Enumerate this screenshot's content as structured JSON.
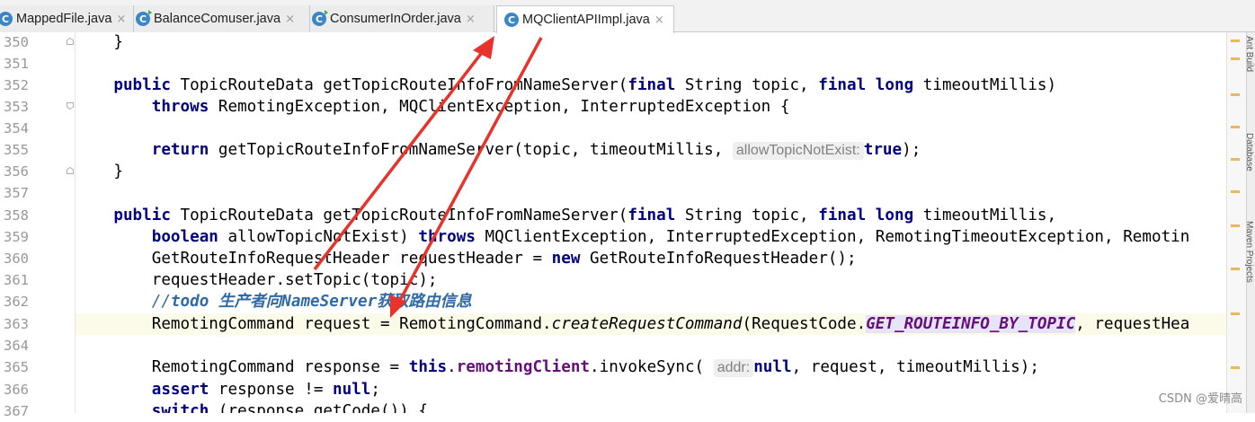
{
  "tabs": [
    {
      "label": "MappedFile.java",
      "icon": "C",
      "run": false
    },
    {
      "label": "BalanceComuser.java",
      "icon": "C",
      "run": true
    },
    {
      "label": "ConsumerInOrder.java",
      "icon": "C",
      "run": true
    },
    {
      "label": "MQClientAPIImpl.java",
      "icon": "C",
      "run": false
    }
  ],
  "close_glyph": "×",
  "line_numbers": [
    "350",
    "351",
    "352",
    "353",
    "354",
    "355",
    "356",
    "357",
    "358",
    "359",
    "360",
    "361",
    "362",
    "363",
    "364",
    "365",
    "366",
    "367"
  ],
  "code": {
    "l350_brace": "}",
    "l352_kw1": "public",
    "l352_a": " TopicRouteData getTopicRouteInfoFromNameServer(",
    "l352_kw2": "final",
    "l352_b": " String topic, ",
    "l352_kw3": "final",
    "l352_c": " ",
    "l352_kw4": "long",
    "l352_d": " timeoutMillis)",
    "l353_kw1": "throws",
    "l353_a": " RemotingException, MQClientException, InterruptedException {",
    "l355_kw1": "return",
    "l355_a": " getTopicRouteInfoFromNameServer(topic, timeoutMillis, ",
    "l355_hint": "allowTopicNotExist:",
    "l355_kw2": "true",
    "l355_b": ");",
    "l356_brace": "}",
    "l358_kw1": "public",
    "l358_a": " TopicRouteData getTopicRouteInfoFromNameServer(",
    "l358_kw2": "final",
    "l358_b": " String topic, ",
    "l358_kw3": "final",
    "l358_c": " ",
    "l358_kw4": "long",
    "l358_d": " timeoutMillis,",
    "l359_kw1": "boolean",
    "l359_a": " allowTopicNotExist) ",
    "l359_kw2": "throws",
    "l359_b": " MQClientException, InterruptedException, RemotingTimeoutException, Remotin",
    "l360_a": "GetRouteInfoRequestHeader requestHeader = ",
    "l360_kw1": "new",
    "l360_b": " GetRouteInfoRequestHeader();",
    "l361_a": "requestHeader.setTopic(topic);",
    "l362_a": "//",
    "l362_b": "todo 生产者向NameServer获取路由信息",
    "l363_a": "RemotingCommand request = RemotingCommand.",
    "l363_static": "createRequestCommand",
    "l363_b": "(RequestCode.",
    "l363_const": "GET_ROUTEINFO_BY_TOPIC",
    "l363_c": ", requestHea",
    "l365_a": "RemotingCommand response = ",
    "l365_kw1": "this",
    "l365_b": ".",
    "l365_field": "remotingClient",
    "l365_c": ".invokeSync( ",
    "l365_hint": "addr:",
    "l365_kw2": "null",
    "l365_d": ", request, timeoutMillis);",
    "l366_kw1": "assert",
    "l366_a": " response != ",
    "l366_kw2": "null",
    "l366_b": ";",
    "l367_kw1": "switch",
    "l367_a": " (response.getCode()) {"
  },
  "side_panel_labels": [
    "Ant Build",
    "Database",
    "Maven Projects"
  ],
  "watermark": "CSDN @爱晴高",
  "colors": {
    "keyword": "#000080",
    "comment": "#2f6aa6",
    "field": "#660e7a",
    "arrow": "#e8322a",
    "current_line": "#fcfae8"
  }
}
